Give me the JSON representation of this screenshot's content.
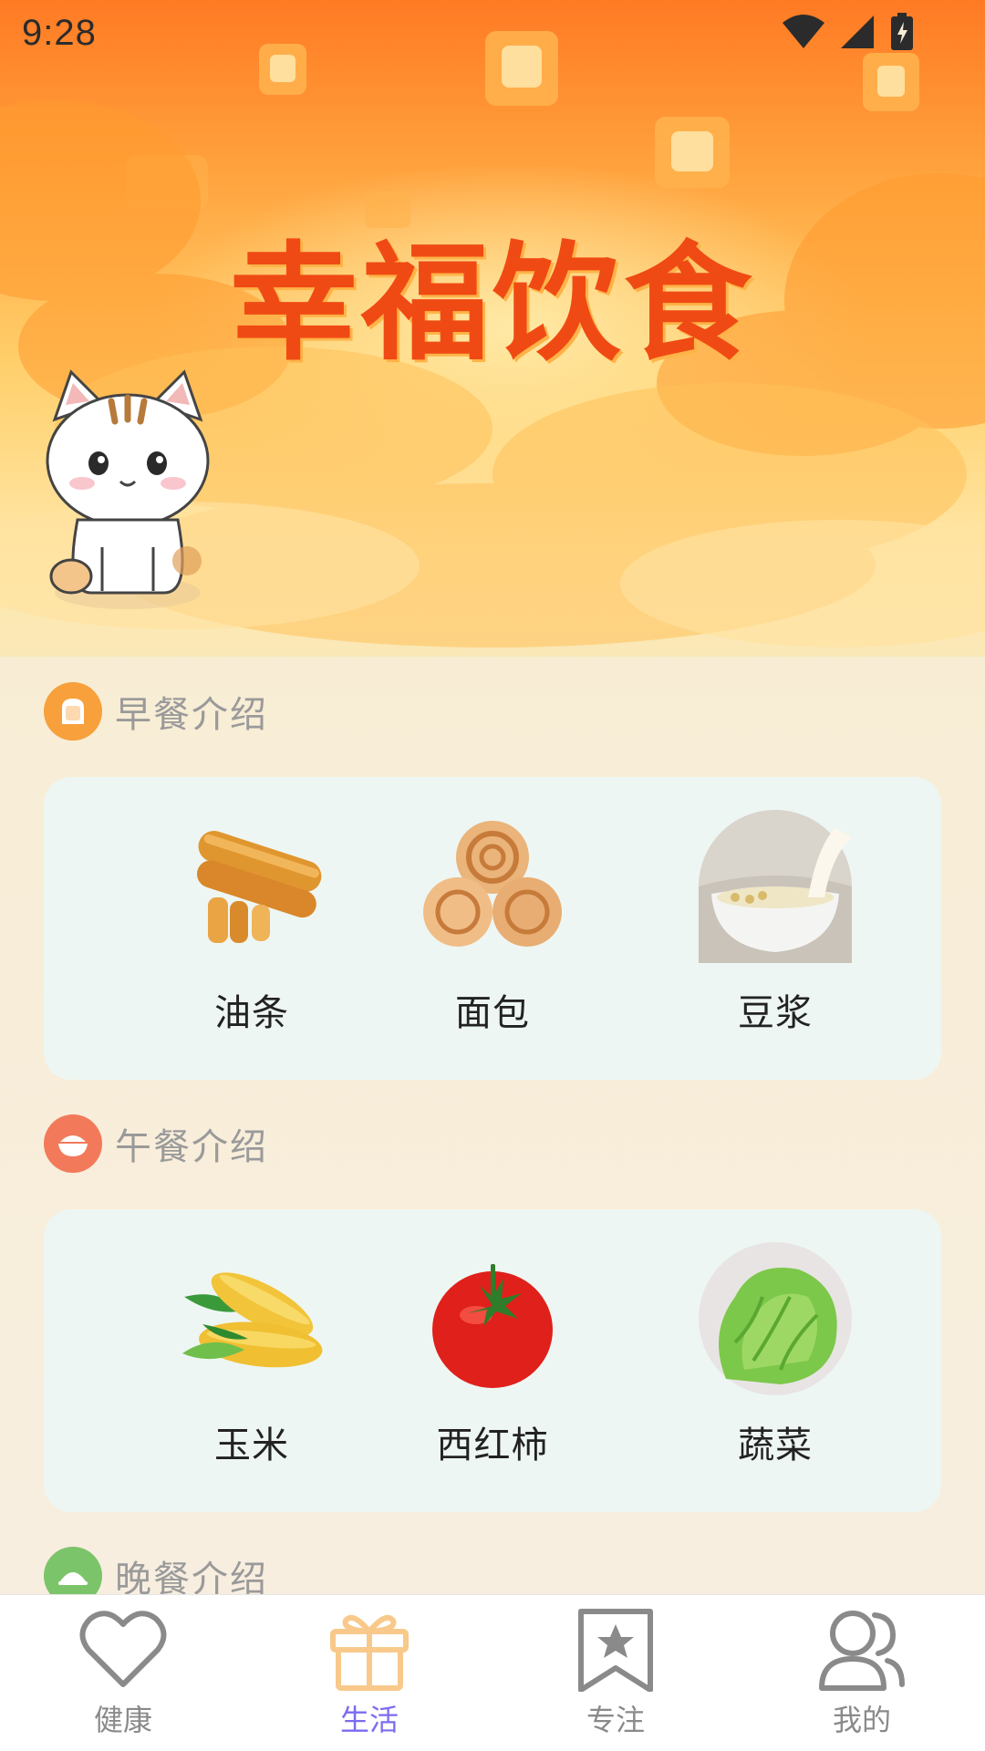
{
  "status_bar": {
    "time": "9:28"
  },
  "banner": {
    "title": "幸福饮食"
  },
  "sections": [
    {
      "title": "早餐介绍",
      "icon": "bread-icon",
      "accent": "#f7a03c",
      "items": [
        {
          "label": "油条",
          "image": "fried-dough-image"
        },
        {
          "label": "面包",
          "image": "bread-rolls-image"
        },
        {
          "label": "豆浆",
          "image": "soy-milk-image"
        }
      ]
    },
    {
      "title": "午餐介绍",
      "icon": "rice-bowl-icon",
      "accent": "#f27a5a",
      "items": [
        {
          "label": "玉米",
          "image": "corn-image"
        },
        {
          "label": "西红柿",
          "image": "tomato-image"
        },
        {
          "label": "蔬菜",
          "image": "lettuce-image"
        }
      ]
    },
    {
      "title": "晚餐介绍",
      "icon": "dinner-icon",
      "accent": "#7cc46a"
    }
  ],
  "bottom_nav": {
    "items": [
      {
        "label": "健康",
        "icon": "heart-icon",
        "active": false
      },
      {
        "label": "生活",
        "icon": "gift-icon",
        "active": true
      },
      {
        "label": "专注",
        "icon": "bookmark-star-icon",
        "active": false
      },
      {
        "label": "我的",
        "icon": "users-icon",
        "active": false
      }
    ],
    "active_color": "#7b6cf0",
    "active_icon_color": "#f8c98a",
    "inactive_color": "#8a8a8a"
  }
}
